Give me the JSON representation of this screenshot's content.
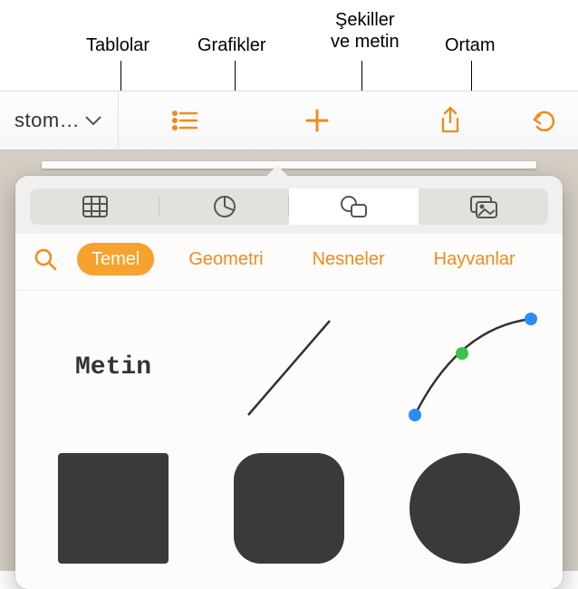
{
  "callouts": {
    "tables": "Tablolar",
    "charts": "Grafikler",
    "shapes_text": "Şekiller\nve metin",
    "media": "Ortam"
  },
  "toolbar": {
    "document_title": "stom…"
  },
  "segments": {
    "tables": "tables",
    "charts": "charts",
    "shapes": "shapes",
    "media": "media"
  },
  "categories": {
    "basic": "Temel",
    "geometry": "Geometri",
    "objects": "Nesneler",
    "animals": "Hayvanlar"
  },
  "shapes": {
    "text_label": "Metin"
  },
  "colors": {
    "accent": "#f28a1c"
  }
}
